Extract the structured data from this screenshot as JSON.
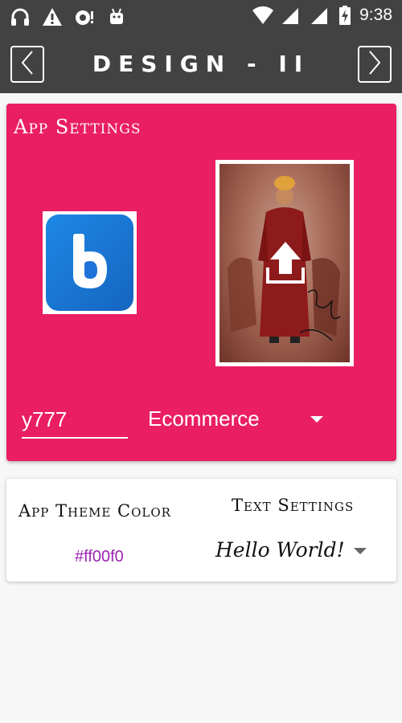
{
  "status_bar": {
    "time": "9:38",
    "left_icons": [
      "headphones-icon",
      "warning-icon",
      "lock-alert-icon",
      "android-icon"
    ],
    "right_icons": [
      "wifi-icon",
      "signal-icon",
      "signal-icon-2",
      "battery-charging-icon"
    ]
  },
  "toolbar": {
    "title": "DESIGN - II",
    "back_icon": "chevron-left-icon",
    "forward_icon": "chevron-right-icon"
  },
  "app_settings": {
    "title": "App Settings",
    "logo_icon": "app-logo-icon",
    "photo_icon": "upload-arrow-icon",
    "name_value": "y777",
    "category": "Ecommerce",
    "card_color": "#ea1e63"
  },
  "theme": {
    "heading": "App Theme Color",
    "color_value": "#ff00f0",
    "value_color": "#9c27b0"
  },
  "text_settings": {
    "heading": "Text Settings",
    "sample_text": "Hello World!"
  }
}
